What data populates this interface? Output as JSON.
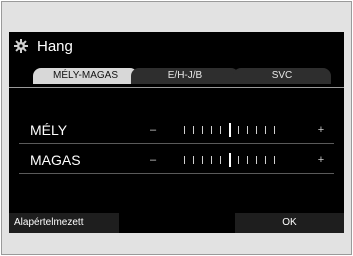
{
  "header": {
    "title": "Hang",
    "icon": "gear-icon"
  },
  "tabs": [
    {
      "label": "MÉLY-MAGAS",
      "active": true
    },
    {
      "label": "E/H-J/B",
      "active": false
    },
    {
      "label": "SVC",
      "active": false
    }
  ],
  "rows": [
    {
      "label": "MÉLY",
      "minus": "–",
      "plus": "+",
      "ticks": 11,
      "level_index": 5
    },
    {
      "label": "MAGAS",
      "minus": "–",
      "plus": "+",
      "ticks": 11,
      "level_index": 5
    }
  ],
  "buttons": {
    "default_label": "Alapértelmezett",
    "ok_label": "OK"
  },
  "colors": {
    "screen_bg": "#000000",
    "tab_active": "#d8d8d8",
    "tab_inactive": "#2e2e2e",
    "frame": "#e2e2e2"
  }
}
